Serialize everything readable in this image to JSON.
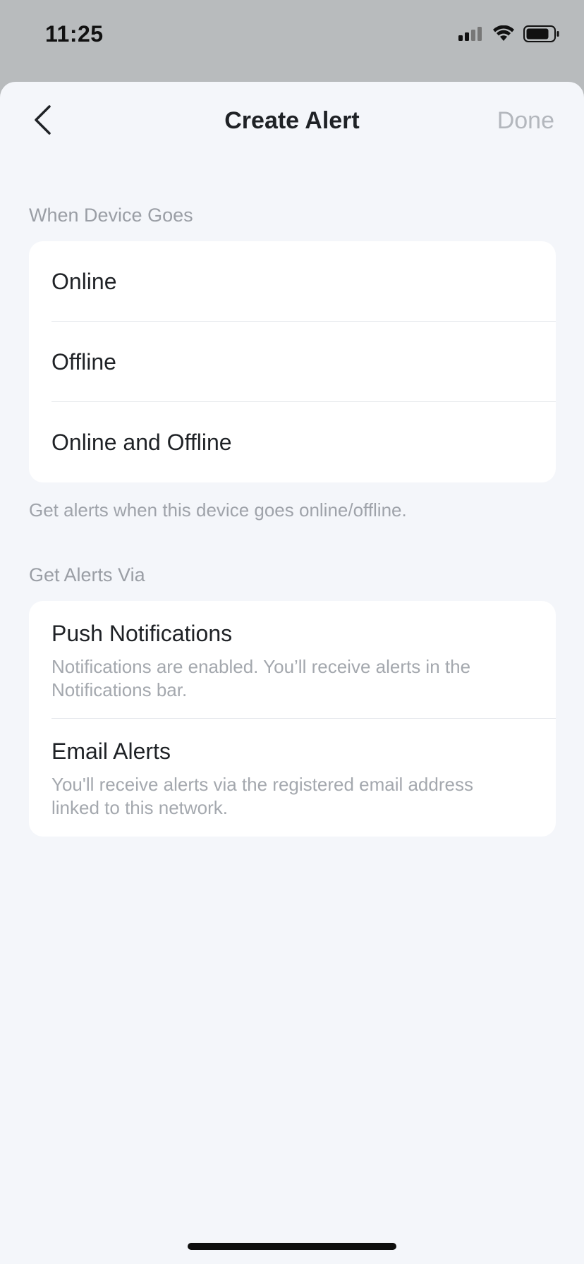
{
  "status_bar": {
    "time": "11:25",
    "icons": [
      "cellular-signal-icon",
      "wifi-icon",
      "battery-icon"
    ]
  },
  "nav": {
    "title": "Create Alert",
    "done_label": "Done",
    "back_icon": "chevron-left-icon"
  },
  "device_goes": {
    "label": "When Device Goes",
    "options": [
      {
        "label": "Online"
      },
      {
        "label": "Offline"
      },
      {
        "label": "Online and Offline"
      }
    ],
    "hint": "Get alerts when this device goes online/offline."
  },
  "alerts_via": {
    "label": "Get Alerts Via",
    "items": [
      {
        "title": "Push Notifications",
        "description": "Notifications are enabled. You’ll receive alerts in the Notifications bar."
      },
      {
        "title": "Email Alerts",
        "description": "You'll receive alerts via the registered email address linked to this network."
      }
    ]
  },
  "colors": {
    "sheet_background": "#f4f6fa",
    "card_background": "#ffffff",
    "text_primary": "#1f2226",
    "text_secondary": "#9a9ea5",
    "done_disabled": "#b3b7bd"
  }
}
